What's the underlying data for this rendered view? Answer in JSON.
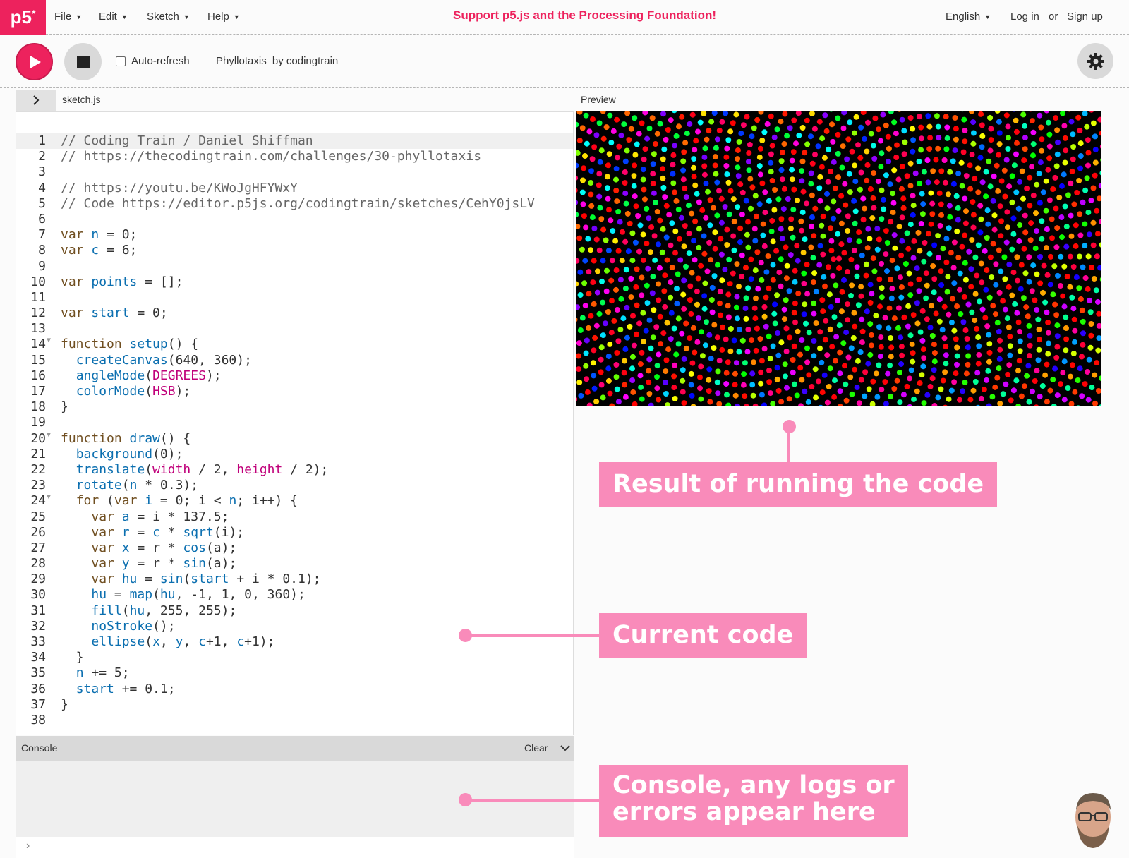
{
  "nav": {
    "logo": "p5",
    "logo_mark": "*",
    "menus": [
      "File",
      "Edit",
      "Sketch",
      "Help"
    ],
    "support": "Support p5.js and the Processing Foundation!",
    "language": "English",
    "login": "Log in",
    "or": "or",
    "signup": "Sign up"
  },
  "toolbar": {
    "auto_refresh": "Auto-refresh",
    "sketch_name": "Phyllotaxis",
    "by": "by codingtrain"
  },
  "editor": {
    "file": "sketch.js",
    "lines": [
      "// Coding Train / Daniel Shiffman",
      "// https://thecodingtrain.com/challenges/30-phyllotaxis",
      "",
      "// https://youtu.be/KWoJgHFYWxY",
      "// Code https://editor.p5js.org/codingtrain/sketches/CehY0jsLV",
      "",
      "var n = 0;",
      "var c = 6;",
      "",
      "var points = [];",
      "",
      "var start = 0;",
      "",
      "function setup() {",
      "  createCanvas(640, 360);",
      "  angleMode(DEGREES);",
      "  colorMode(HSB);",
      "}",
      "",
      "function draw() {",
      "  background(0);",
      "  translate(width / 2, height / 2);",
      "  rotate(n * 0.3);",
      "  for (var i = 0; i < n; i++) {",
      "    var a = i * 137.5;",
      "    var r = c * sqrt(i);",
      "    var x = r * cos(a);",
      "    var y = r * sin(a);",
      "    var hu = sin(start + i * 0.1);",
      "    hu = map(hu, -1, 1, 0, 360);",
      "    fill(hu, 255, 255);",
      "    noStroke();",
      "    ellipse(x, y, c+1, c+1);",
      "  }",
      "  n += 5;",
      "  start += 0.1;",
      "}",
      ""
    ],
    "fold_lines": [
      14,
      20,
      24
    ]
  },
  "preview": {
    "label": "Preview"
  },
  "console": {
    "title": "Console",
    "clear": "Clear",
    "prompt": "›"
  },
  "annotations": {
    "result": "Result of running the code",
    "code": "Current code",
    "console_line1": "Console, any logs or",
    "console_line2": "errors appear here"
  },
  "colors": {
    "accent": "#ed225d",
    "callout": "#f98bba"
  },
  "icons": {
    "play": "play-icon",
    "stop": "stop-icon",
    "gear": "gear-icon",
    "expand": "chevron-right-icon",
    "collapse": "chevron-down-icon"
  }
}
